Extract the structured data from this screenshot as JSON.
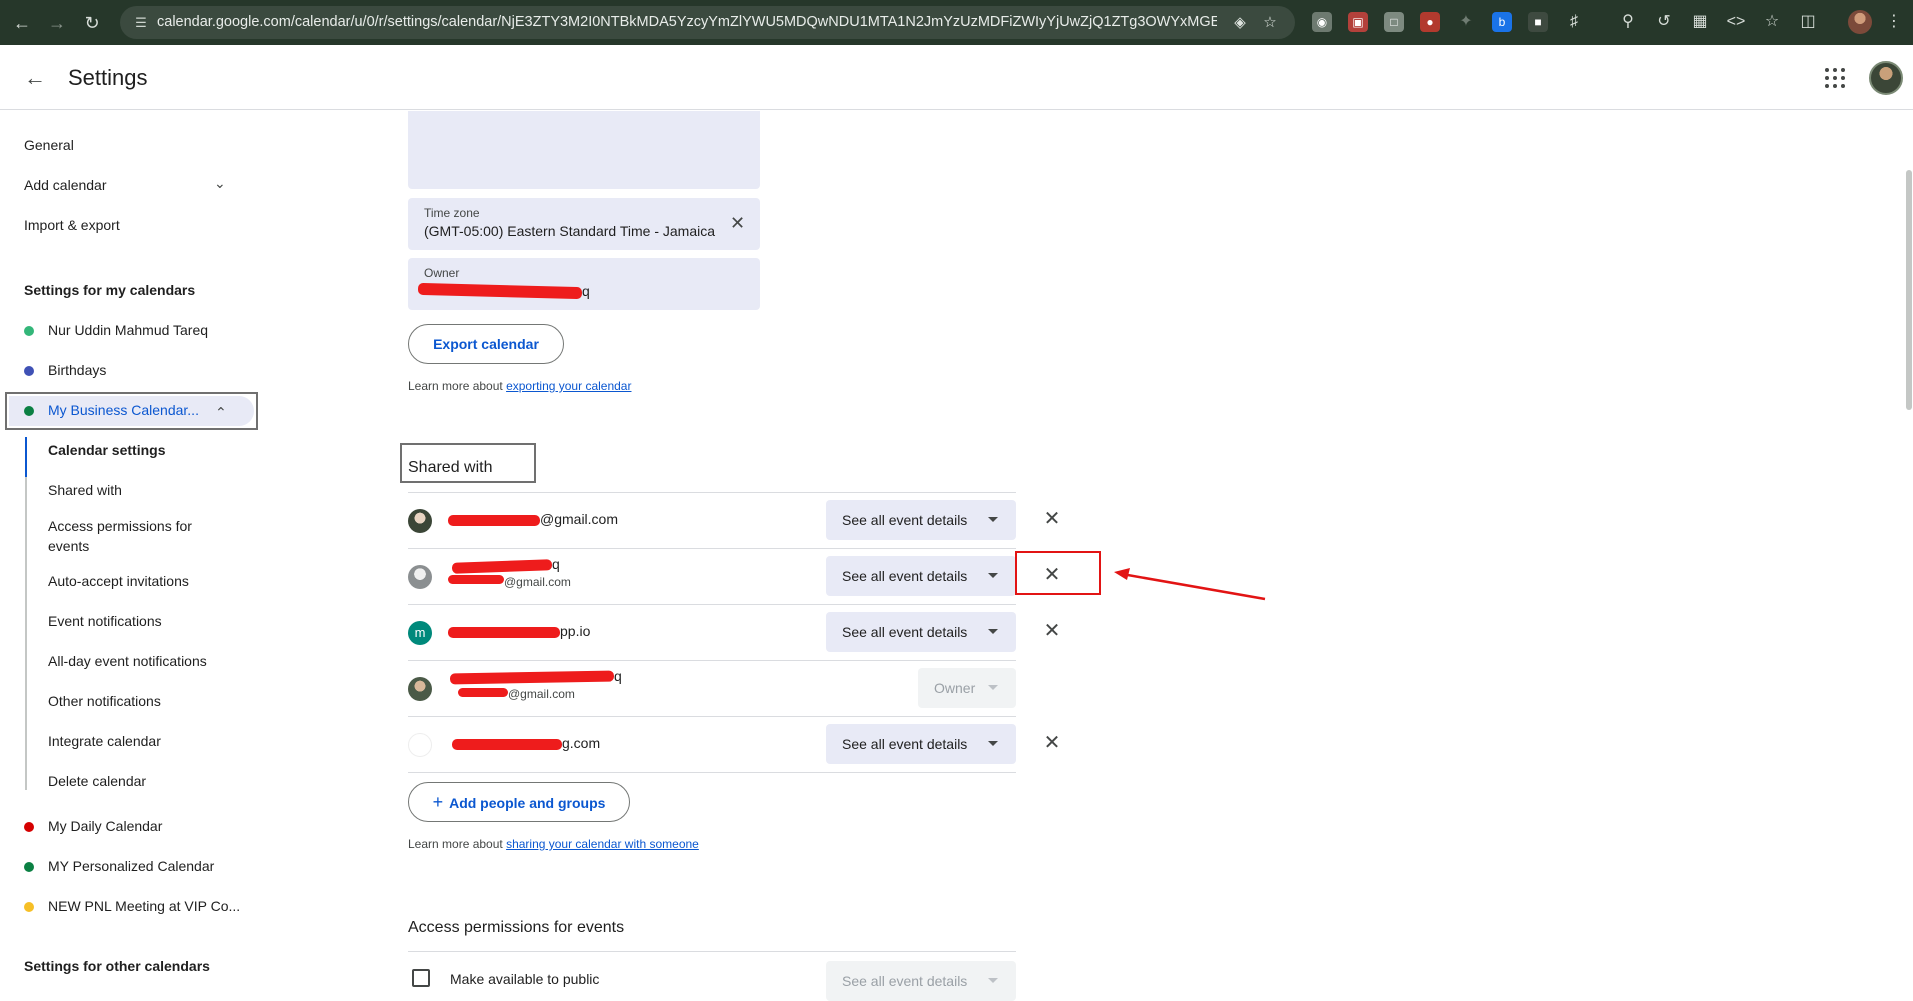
{
  "browser": {
    "url": "calendar.google.com/calendar/u/0/r/settings/calendar/NjE3ZTY3M2I0NTBkMDA5YzcyYmZlYWU5MDQwNDU1MTA1N2JmYzUzMDFiZWIyYjUwZjQ1ZTg3OWYxMGEwNWVk..."
  },
  "header": {
    "title": "Settings"
  },
  "sidebar": {
    "general": "General",
    "add_calendar": "Add calendar",
    "import_export": "Import & export",
    "my_calendars_heading": "Settings for my calendars",
    "calendars": [
      {
        "name": "Nur Uddin Mahmud Tareq",
        "color": "#33b679"
      },
      {
        "name": "Birthdays",
        "color": "#3f51b5"
      },
      {
        "name": "My Business Calendar...",
        "color": "#0b8043"
      }
    ],
    "sub_items": [
      "Calendar settings",
      "Shared with",
      "Access permissions for events",
      "Auto-accept invitations",
      "Event notifications",
      "All-day event notifications",
      "Other notifications",
      "Integrate calendar",
      "Delete calendar"
    ],
    "more_calendars": [
      {
        "name": "My Daily Calendar",
        "color": "#d50000"
      },
      {
        "name": "MY Personalized Calendar",
        "color": "#0b8043"
      },
      {
        "name": "NEW PNL Meeting at VIP Co...",
        "color": "#f6bf26"
      }
    ],
    "other_calendars_heading": "Settings for other calendars"
  },
  "main": {
    "timezone": {
      "label": "Time zone",
      "value": "(GMT-05:00) Eastern Standard Time - Jamaica"
    },
    "owner": {
      "label": "Owner",
      "value_tail": "q"
    },
    "export_button": "Export calendar",
    "export_learn_prefix": "Learn more about ",
    "export_learn_link": "exporting your calendar",
    "shared_with_title": "Shared with",
    "shares": [
      {
        "email_tail": "@gmail.com",
        "sub_tail": "",
        "permission": "See all event details",
        "removable": true,
        "avatar_color": "#3b4637"
      },
      {
        "email_tail": "q",
        "sub_tail": "@gmail.com",
        "permission": "See all event details",
        "removable": true,
        "avatar_color": "#8b8f91"
      },
      {
        "email_tail": "pp.io",
        "sub_tail": "",
        "permission": "See all event details",
        "removable": true,
        "avatar_color": "#00897b",
        "avatar_letter": "m"
      },
      {
        "email_tail": "q",
        "sub_tail": "@gmail.com",
        "permission": "Owner",
        "removable": false,
        "avatar_color": "#4a5a47"
      },
      {
        "email_tail": "g.com",
        "sub_tail": "",
        "permission": "See all event details",
        "removable": true,
        "avatar_color": "#ffffff"
      }
    ],
    "add_people_button": "Add people and groups",
    "share_learn_prefix": "Learn more about ",
    "share_learn_link": "sharing your calendar with someone",
    "access_title": "Access permissions for events",
    "make_public_label": "Make available to public",
    "make_public_permission": "See all event details"
  },
  "colors": {
    "accent": "#0b57d0",
    "field_bg": "#e8eaf6",
    "annotation": "#e21414"
  }
}
